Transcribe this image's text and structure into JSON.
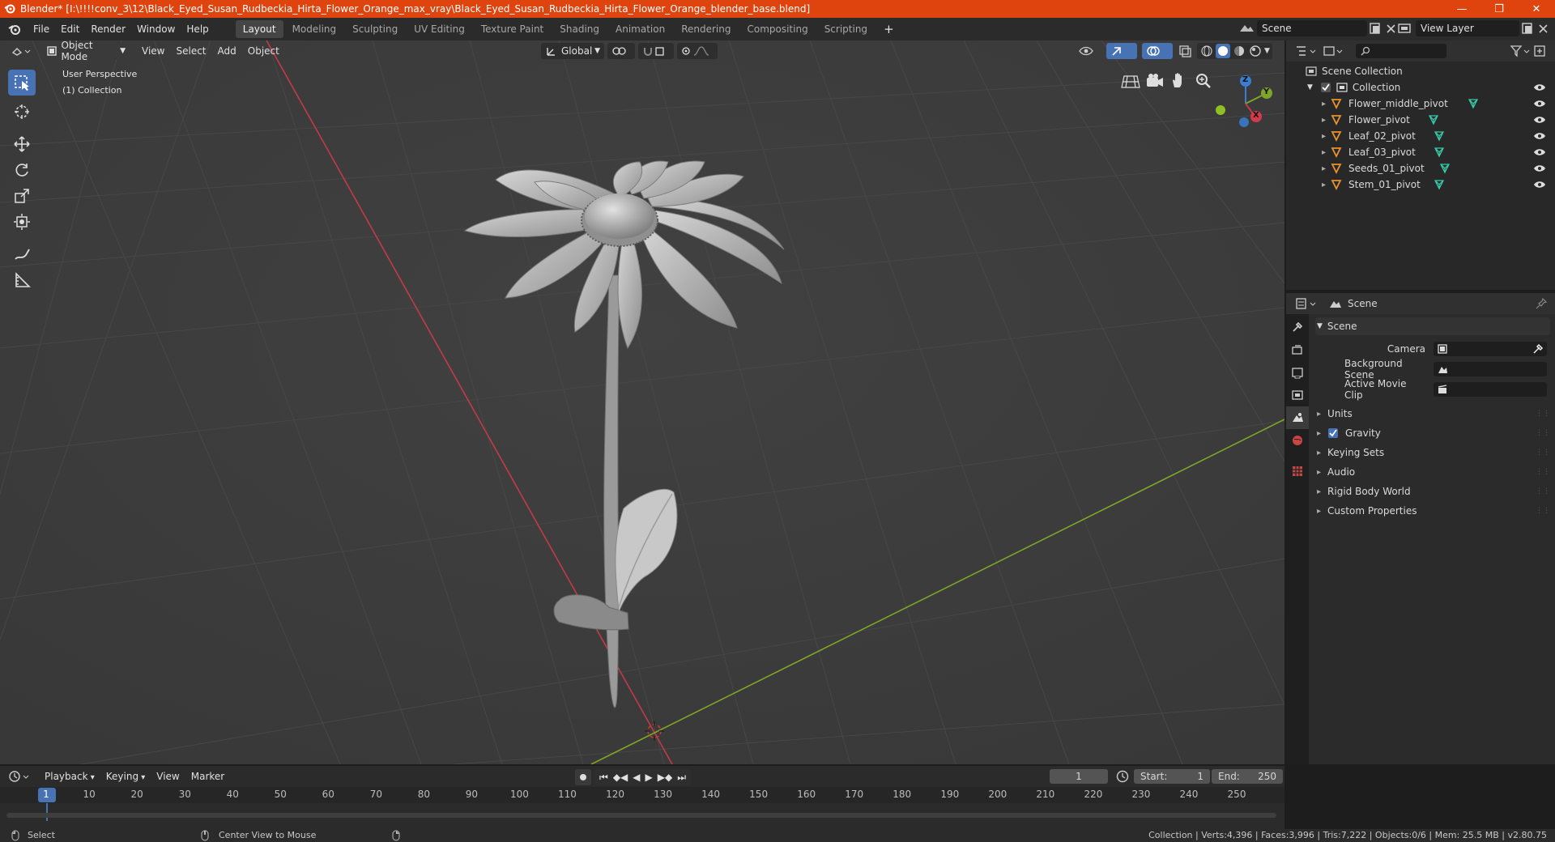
{
  "window": {
    "title": "Blender* [I:\\!!!!conv_3\\12\\Black_Eyed_Susan_Rudbeckia_Hirta_Flower_Orange_max_vray\\Black_Eyed_Susan_Rudbeckia_Hirta_Flower_Orange_blender_base.blend]",
    "minimize": "—",
    "maximize": "❐",
    "close": "✕"
  },
  "menu": [
    "File",
    "Edit",
    "Render",
    "Window",
    "Help"
  ],
  "workspaces": [
    "Layout",
    "Modeling",
    "Sculpting",
    "UV Editing",
    "Texture Paint",
    "Shading",
    "Animation",
    "Rendering",
    "Compositing",
    "Scripting"
  ],
  "workspace_add": "+",
  "scene_field": "Scene",
  "viewlayer_field": "View Layer",
  "viewport": {
    "mode": "Object Mode",
    "menus": [
      "View",
      "Select",
      "Add",
      "Object"
    ],
    "transform_orientation": "Global",
    "perspective_label": "User Perspective",
    "collection_label": "(1) Collection",
    "gizmo": {
      "x": "X",
      "y": "Y",
      "z": "Z"
    }
  },
  "outliner": {
    "root": "Scene Collection",
    "collection": "Collection",
    "objects": [
      "Flower_middle_pivot",
      "Flower_pivot",
      "Leaf_02_pivot",
      "Leaf_03_pivot",
      "Seeds_01_pivot",
      "Stem_01_pivot"
    ]
  },
  "properties": {
    "header": "Scene",
    "panel": "Scene",
    "fields": [
      {
        "label": "Camera",
        "value": ""
      },
      {
        "label": "Background Scene",
        "value": ""
      },
      {
        "label": "Active Movie Clip",
        "value": ""
      }
    ],
    "sections": [
      "Units",
      "Gravity",
      "Keying Sets",
      "Audio",
      "Rigid Body World",
      "Custom Properties"
    ],
    "gravity_checked": true
  },
  "timeline": {
    "menus": [
      "Playback",
      "Keying",
      "View",
      "Marker"
    ],
    "current_frame": "1",
    "start_label": "Start:",
    "start": "1",
    "end_label": "End:",
    "end": "250",
    "ruler": [
      "1",
      "10",
      "20",
      "30",
      "40",
      "50",
      "60",
      "70",
      "80",
      "90",
      "100",
      "110",
      "120",
      "130",
      "140",
      "150",
      "160",
      "170",
      "180",
      "190",
      "200",
      "210",
      "220",
      "230",
      "240",
      "250"
    ]
  },
  "statusbar": {
    "select": "Select",
    "center_view": "Center View to Mouse",
    "stats": "Collection | Verts:4,396 | Faces:3,996 | Tris:7,222 | Objects:0/6 | Mem: 25.5 MB | v2.80.75"
  },
  "colors": {
    "titlebar": "#e0440e",
    "accent": "#4772b3",
    "x_axis": "#c13b48",
    "y_axis": "#7ea528",
    "z_axis": "#3b7ed1",
    "object_icon": "#e8922e",
    "mesh_icon": "#37c9a8"
  }
}
